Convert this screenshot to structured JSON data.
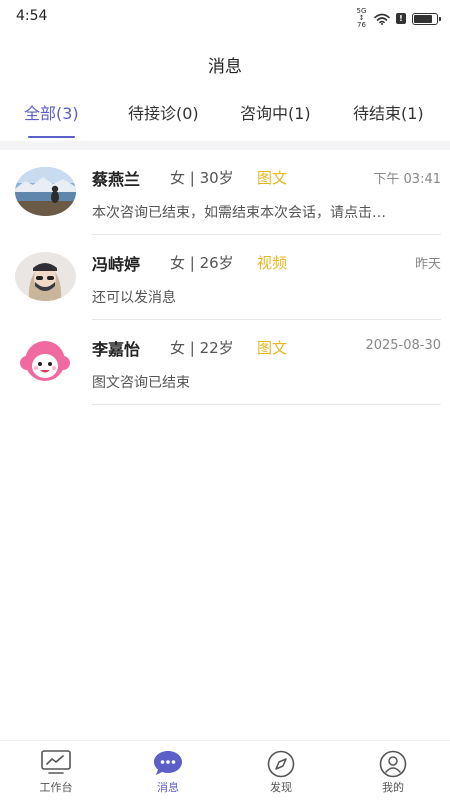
{
  "status_bar": {
    "time": "4:54",
    "net_label": "5G ↕ 76",
    "badge": "!",
    "battery_level": 0.8
  },
  "header": {
    "title": "消息"
  },
  "tabs": [
    {
      "label": "全部(3)",
      "active": true
    },
    {
      "label": "待接诊(0)",
      "active": false
    },
    {
      "label": "咨询中(1)",
      "active": false
    },
    {
      "label": "待结束(1)",
      "active": false
    }
  ],
  "messages": [
    {
      "name": "蔡燕兰",
      "meta": "女 | 30岁",
      "type": "图文",
      "time": "下午 03:41",
      "preview": "本次咨询已结束，如需结束本次会话，请点击…"
    },
    {
      "name": "冯峙婷",
      "meta": "女 | 26岁",
      "type": "视频",
      "time": "昨天",
      "preview": "还可以发消息"
    },
    {
      "name": "李嘉怡",
      "meta": "女 | 22岁",
      "type": "图文",
      "time": "2025-08-30",
      "preview": "图文咨询已结束"
    }
  ],
  "bottom_nav": [
    {
      "label": "工作台",
      "icon": "monitor-icon",
      "active": false
    },
    {
      "label": "消息",
      "icon": "chat-bubble-icon",
      "active": true
    },
    {
      "label": "发现",
      "icon": "compass-icon",
      "active": false
    },
    {
      "label": "我的",
      "icon": "user-icon",
      "active": false
    }
  ],
  "colors": {
    "accent": "#5b5fc7",
    "type_tag": "#e8b624",
    "divider_band": "#f4f4f6"
  }
}
